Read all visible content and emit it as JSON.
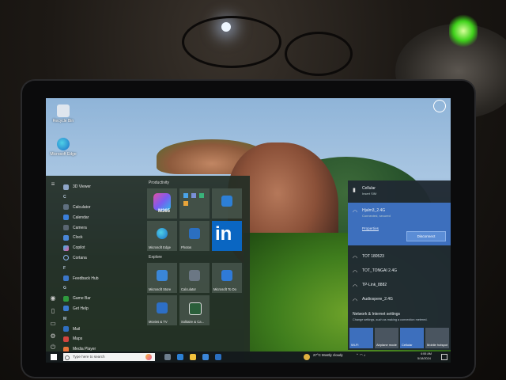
{
  "desktop": {
    "icons": [
      {
        "label": "Recycle Bin",
        "icon": "recycle-bin-icon"
      },
      {
        "label": "Microsoft Edge",
        "icon": "edge-icon"
      }
    ]
  },
  "start_menu": {
    "applist": [
      {
        "label": "3D Viewer",
        "kind": "app"
      },
      {
        "label": "C",
        "kind": "letter"
      },
      {
        "label": "Calculator",
        "kind": "app"
      },
      {
        "label": "Calendar",
        "kind": "app"
      },
      {
        "label": "Camera",
        "kind": "app"
      },
      {
        "label": "Clock",
        "kind": "app"
      },
      {
        "label": "Copilot",
        "kind": "app"
      },
      {
        "label": "Cortana",
        "kind": "app"
      },
      {
        "label": "F",
        "kind": "letter"
      },
      {
        "label": "Feedback Hub",
        "kind": "app"
      },
      {
        "label": "G",
        "kind": "letter"
      },
      {
        "label": "Game Bar",
        "kind": "app"
      },
      {
        "label": "Get Help",
        "kind": "app"
      },
      {
        "label": "M",
        "kind": "letter"
      },
      {
        "label": "Mail",
        "kind": "app"
      },
      {
        "label": "Maps",
        "kind": "app"
      },
      {
        "label": "Media Player",
        "kind": "app"
      }
    ],
    "groups": [
      {
        "label": "Productivity",
        "tiles": [
          {
            "label": "",
            "icon": "m365-icon"
          },
          {
            "label": "",
            "icon": "apps-cluster-icon"
          },
          {
            "label": "",
            "icon": "mail-icon"
          },
          {
            "label": "Microsoft Edge",
            "icon": "edge-icon"
          },
          {
            "label": "Photos",
            "icon": "photos-icon"
          },
          {
            "label": "",
            "icon": "linkedin-icon"
          }
        ]
      },
      {
        "label": "Explore",
        "tiles": [
          {
            "label": "Microsoft Store",
            "icon": "store-icon"
          },
          {
            "label": "Calculator",
            "icon": "calculator-icon"
          },
          {
            "label": "Microsoft To Do",
            "icon": "todo-icon"
          },
          {
            "label": "Movies & TV",
            "icon": "movies-icon"
          },
          {
            "label": "Solitaire & Ca...",
            "icon": "solitaire-icon"
          }
        ]
      }
    ],
    "m365_label": "M365",
    "linkedin_label": "in"
  },
  "network": {
    "cellular": {
      "name": "Cellular",
      "sub": "Insert SIM"
    },
    "connected": {
      "name": "Hjalm3_2.4G",
      "sub": "Connected, secured",
      "properties": "Properties",
      "disconnect": "Disconnect"
    },
    "list": [
      {
        "name": "TOT 180523"
      },
      {
        "name": "TOT_TONGAI 2.4G"
      },
      {
        "name": "TP-Link_8882"
      },
      {
        "name": "Audiospere_2.4G"
      }
    ],
    "settings_title": "Network & Internet settings",
    "settings_sub": "Change settings, such as making a connection metered.",
    "quick": [
      {
        "label": "Wi-Fi",
        "active": true
      },
      {
        "label": "Airplane mode",
        "active": false
      },
      {
        "label": "Cellular",
        "active": true
      },
      {
        "label": "Mobile hotspot",
        "active": false
      }
    ]
  },
  "taskbar": {
    "search_placeholder": "Type here to search",
    "weather": "27°C  Mostly cloudy",
    "time": "4:06 AM",
    "date": "5/18/2024"
  },
  "colors": {
    "accent_blue": "#3d6fbd",
    "tile_bg": "#46554b",
    "linkedin": "#0a66c2"
  }
}
